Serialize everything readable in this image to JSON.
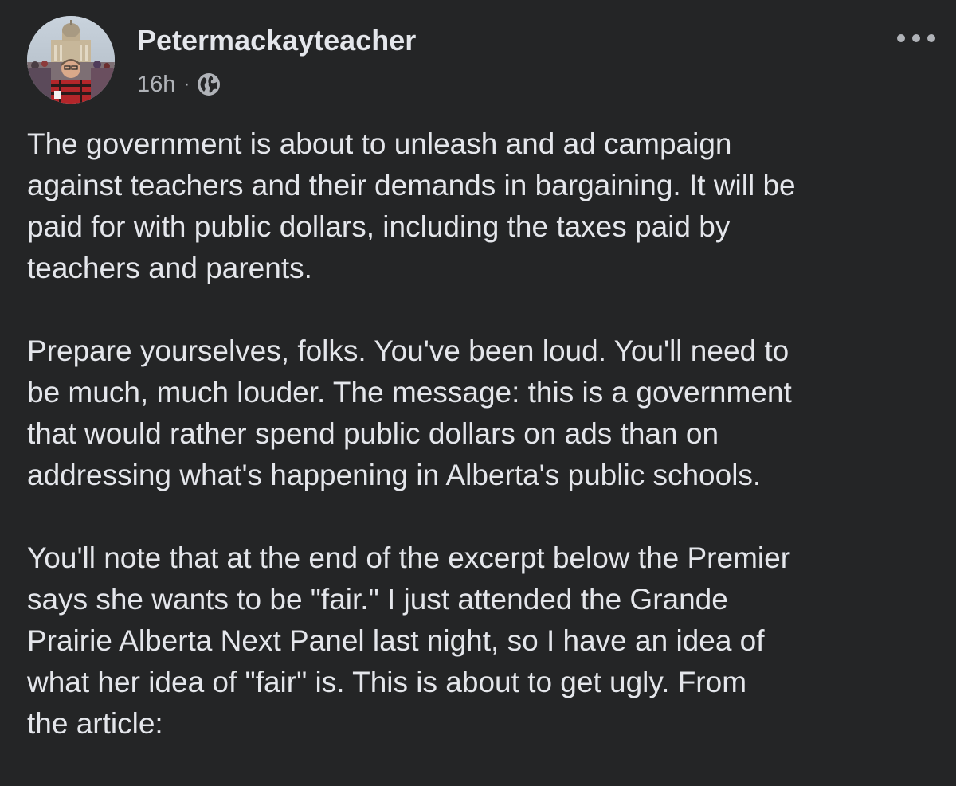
{
  "post": {
    "author": "Petermackayteacher",
    "time": "16h",
    "separator": "·",
    "audience_icon": "globe-icon",
    "menu_icon": "more-options-icon",
    "paragraphs": [
      "The government is about to unleash and ad campaign\nagainst teachers and their demands in bargaining.  It will be\npaid for with public dollars, including the taxes paid by\nteachers and parents.",
      "Prepare yourselves, folks.  You've been loud.  You'll need to\nbe much, much louder.  The message: this is a government\nthat would rather spend public dollars on ads than on\naddressing what's happening in Alberta's public schools.",
      "You'll note that at the end of the excerpt below the Premier\nsays she wants to be \"fair.\"  I just attended the Grande\nPrairie Alberta Next Panel last night, so I have an idea of\nwhat her idea of \"fair\" is.  This is about to get ugly.  From\nthe article:"
    ]
  },
  "colors": {
    "background": "#242526",
    "primary_text": "#e4e6eb",
    "secondary_text": "#b0b3b8"
  }
}
